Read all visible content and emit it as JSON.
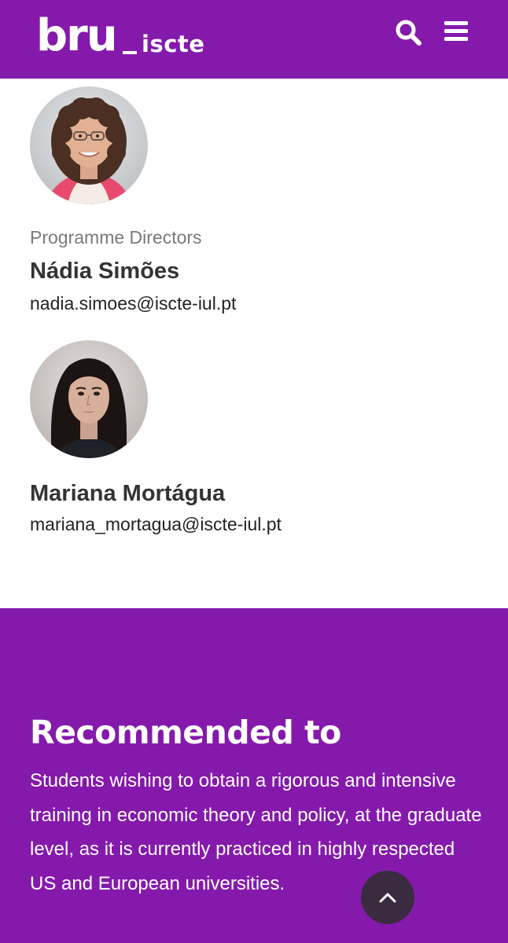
{
  "header": {
    "logo_main": "bru",
    "logo_secondary": "iscte",
    "background": "#8519ac",
    "search_icon": "search-icon",
    "menu_icon": "hamburger-menu-icon"
  },
  "people": [
    {
      "role": "",
      "name": "",
      "email": "",
      "avatar_icon": "portrait-photo"
    },
    {
      "role": "Programme Directors",
      "name": "Nádia Simões",
      "email": "nadia.simoes@iscte-iul.pt",
      "avatar_icon": "portrait-photo"
    },
    {
      "role": "",
      "name": "Mariana Mortágua",
      "email": "mariana_mortagua@iscte-iul.pt",
      "avatar_icon": "portrait-photo"
    }
  ],
  "recommended": {
    "title": "Recommended to",
    "text": "Students wishing to obtain a rigorous and intensive training in economic theory and policy, at the graduate level, as it is currently practiced in highly respected US and European universities."
  },
  "scroll_top": {
    "icon": "chevron-up-icon",
    "color": "#3a2b41"
  },
  "colors": {
    "brand_purple": "#8519ac",
    "role_gray": "#7a7a7a",
    "name_dark": "#333333"
  }
}
